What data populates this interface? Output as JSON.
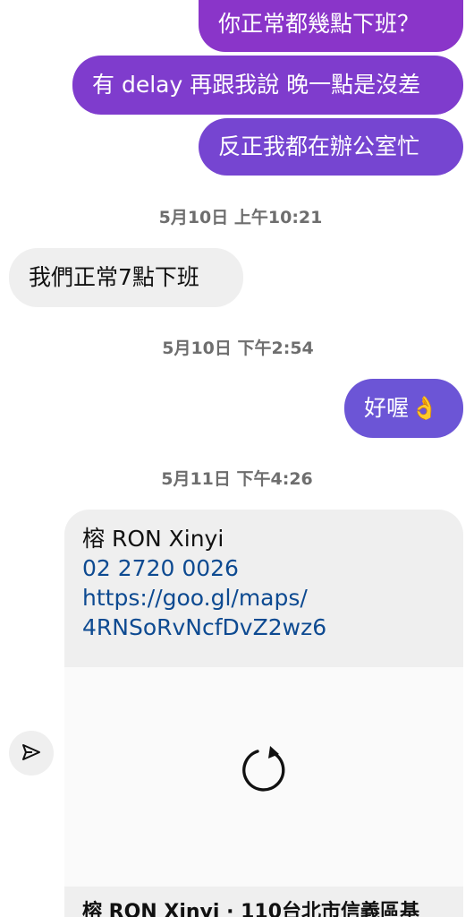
{
  "messages": {
    "sent_1": "你正常都幾點下班？",
    "sent_2": "有 delay 再跟我說 晚一點是沒差",
    "sent_3": "反正我都在辦公室忙",
    "received_1": "我們正常7點下班",
    "sent_4_text": "好喔",
    "sent_4_emoji": "👌"
  },
  "timestamps": {
    "t1": "5月10日 上午10:21",
    "t2": "5月10日 下午2:54",
    "t3": "5月11日 下午4:26"
  },
  "shared_card": {
    "title": "榕 RON Xinyi",
    "phone": "02 2720 0026",
    "url_line_1": "https://goo.gl/maps/",
    "url_line_2": "4RNSoRvNcfDvZ2wz6",
    "footer_title": "榕 RON Xinyi · 110台北市信義區基"
  },
  "icons": {
    "share": "send-icon",
    "loading": "refresh-icon"
  },
  "colors": {
    "sent_gradient_top": "#8a35c9",
    "sent_gradient_bottom": "#6c55d6",
    "received_bg": "#efefef",
    "link": "#0d4a91",
    "timestamp": "#6e6e6e"
  }
}
